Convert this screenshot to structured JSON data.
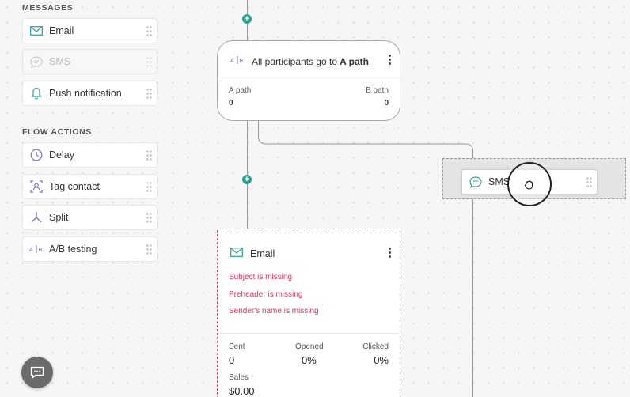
{
  "sidebar": {
    "messages_title": "MESSAGES",
    "messages": [
      {
        "label": "Email",
        "icon": "envelope-icon"
      },
      {
        "label": "SMS",
        "icon": "sms-bubble-icon",
        "disabled": true
      },
      {
        "label": "Push notification",
        "icon": "bell-icon"
      }
    ],
    "flow_title": "FLOW ACTIONS",
    "actions": [
      {
        "label": "Delay",
        "icon": "clock-icon"
      },
      {
        "label": "Tag contact",
        "icon": "tag-contact-icon"
      },
      {
        "label": "Split",
        "icon": "split-icon"
      },
      {
        "label": "A/B testing",
        "icon": "ab-test-icon"
      }
    ]
  },
  "ab_node": {
    "title_prefix": "All participants go to",
    "title_bold": "A path",
    "path_a_label": "A path",
    "path_a_value": "0",
    "path_b_label": "B path",
    "path_b_value": "0"
  },
  "drag_item": {
    "label": "SMS",
    "icon": "sms-bubble-icon"
  },
  "email_node": {
    "title": "Email",
    "errors": [
      "Subject is missing",
      "Preheader is missing",
      "Sender's name is missing"
    ],
    "sent_label": "Sent",
    "sent_value": "0",
    "opened_label": "Opened",
    "opened_value": "0%",
    "clicked_label": "Clicked",
    "clicked_value": "0%",
    "sales_label": "Sales",
    "sales_value": "$0.00"
  },
  "colors": {
    "accent_green": "#2fa38f",
    "error_red": "#e0365a",
    "icon_teal": "#3aa597",
    "icon_purple": "#7a6fc9"
  }
}
